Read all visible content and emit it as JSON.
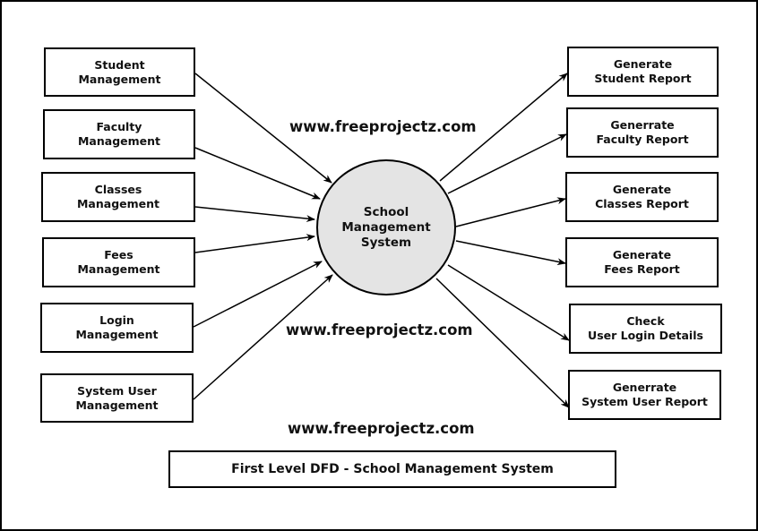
{
  "diagram": {
    "type": "Data Flow Diagram (Level 1)",
    "central_process": {
      "label": "School\nManagement\nSystem",
      "fill": "#e4e4e4"
    },
    "input_entities": [
      {
        "id": "student",
        "label": "Student\nManagement"
      },
      {
        "id": "faculty",
        "label": "Faculty\nManagement"
      },
      {
        "id": "classes",
        "label": "Classes\nManagement"
      },
      {
        "id": "fees",
        "label": "Fees\nManagement"
      },
      {
        "id": "login",
        "label": "Login\nManagement"
      },
      {
        "id": "system-user",
        "label": "System User\nManagement"
      }
    ],
    "output_entities": [
      {
        "id": "student-report",
        "label": "Generate\nStudent Report"
      },
      {
        "id": "faculty-report",
        "label": "Generrate\nFaculty Report"
      },
      {
        "id": "classes-report",
        "label": "Generate\nClasses Report"
      },
      {
        "id": "fees-report",
        "label": "Generate\nFees Report"
      },
      {
        "id": "login-details",
        "label": "Check\nUser Login Details"
      },
      {
        "id": "system-user-report",
        "label": "Generrate\nSystem User Report"
      }
    ],
    "flows": [
      {
        "from": "student",
        "to": "process"
      },
      {
        "from": "faculty",
        "to": "process"
      },
      {
        "from": "classes",
        "to": "process"
      },
      {
        "from": "fees",
        "to": "process"
      },
      {
        "from": "login",
        "to": "process"
      },
      {
        "from": "system-user",
        "to": "process"
      },
      {
        "from": "process",
        "to": "student-report"
      },
      {
        "from": "process",
        "to": "faculty-report"
      },
      {
        "from": "process",
        "to": "classes-report"
      },
      {
        "from": "process",
        "to": "fees-report"
      },
      {
        "from": "process",
        "to": "login-details"
      },
      {
        "from": "process",
        "to": "system-user-report"
      }
    ],
    "watermarks": [
      "www.freeprojectz.com",
      "www.freeprojectz.com",
      "www.freeprojectz.com"
    ],
    "caption": "First Level DFD - School Management System"
  }
}
